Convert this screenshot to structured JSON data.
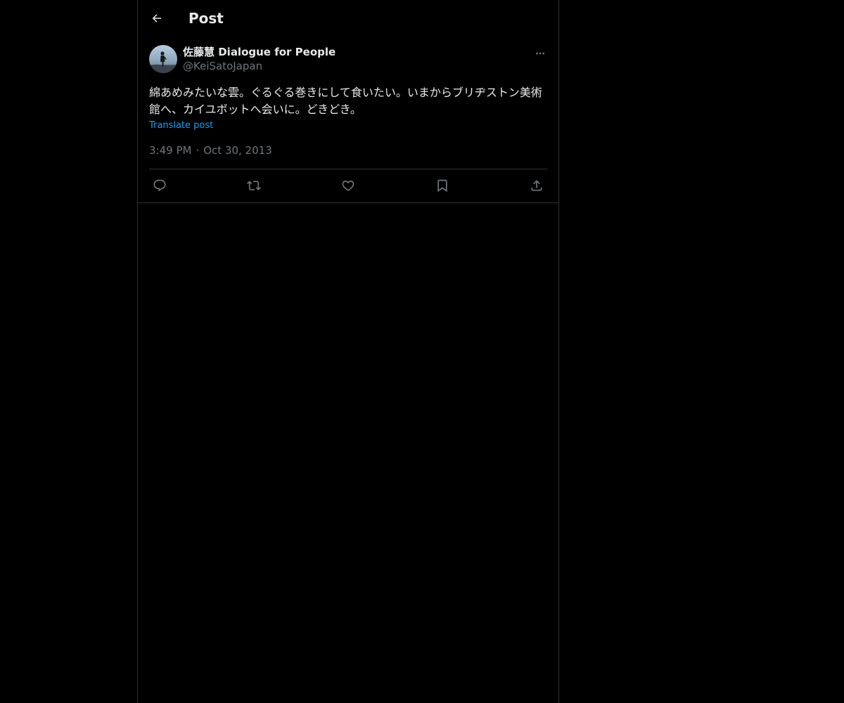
{
  "header": {
    "back_icon": "arrow-left-icon",
    "title": "Post"
  },
  "post": {
    "author": {
      "display_name": "佐藤慧 Dialogue for People",
      "handle": "@KeiSatoJapan",
      "avatar": "avatar"
    },
    "more_icon": "ellipsis-icon",
    "text": "綿あめみたいな雲。ぐるぐる巻きにして食いたい。いまからブリヂストン美術館へ、カイユボットへ会いに。どきどき。",
    "translate_label": "Translate post",
    "time": "3:49 PM",
    "separator": "·",
    "date": "Oct 30, 2013"
  },
  "actions": {
    "reply_icon": "reply-icon",
    "repost_icon": "repost-icon",
    "like_icon": "heart-icon",
    "bookmark_icon": "bookmark-icon",
    "share_icon": "share-icon"
  },
  "colors": {
    "background": "#000000",
    "text": "#e7e9ea",
    "muted": "#71767b",
    "link": "#1d9bf0",
    "border": "#2f3336"
  }
}
